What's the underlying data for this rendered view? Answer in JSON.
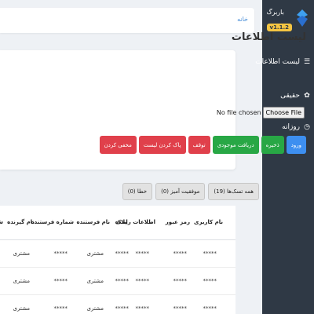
{
  "sidebar": {
    "brand_name": "باربرگ",
    "brand_version": "v1.1.2",
    "items": [
      {
        "label": "لیست اطلاعات",
        "icon": "list-icon"
      },
      {
        "label": "حقیقی",
        "icon": "paw-icon"
      },
      {
        "label": "روزانه",
        "icon": "clock-icon"
      }
    ]
  },
  "header": {
    "breadcrumb": "خانه"
  },
  "card": {
    "title": "لیست اطلاعات",
    "file_button": "Choose File",
    "file_status": "No file chosen",
    "buttons": [
      {
        "label": "ورود",
        "color": "#3d8ff0"
      },
      {
        "label": "ذخیره",
        "color": "#28a745"
      },
      {
        "label": "دریافت موجودی",
        "color": "#28a745"
      },
      {
        "label": "توقف",
        "color": "#e0404b"
      },
      {
        "label": "پاک کردن لیست",
        "color": "#e0404b"
      },
      {
        "label": "مخفی کردن",
        "color": "#e0404b"
      }
    ]
  },
  "filters": [
    {
      "label": "همه تسک‌ها (19)"
    },
    {
      "label": "موفقیت آمیز (0)"
    },
    {
      "label": "خطا (0)"
    }
  ],
  "table": {
    "columns": [
      "نام کاربری",
      "رمز عبور",
      "اطلاعات راننده",
      "پلاک",
      "نام فرستنده",
      "شماره فرستنده",
      "نام گیرنده",
      "ش"
    ],
    "rows": [
      [
        "*****",
        "*****",
        "*****",
        "*****",
        "مشتری",
        "*****",
        "مشتری"
      ],
      [
        "*****",
        "*****",
        "*****",
        "*****",
        "مشتری",
        "*****",
        "مشتری"
      ],
      [
        "*****",
        "*****",
        "*****",
        "*****",
        "مشتری",
        "*****",
        "مشتری"
      ]
    ]
  }
}
